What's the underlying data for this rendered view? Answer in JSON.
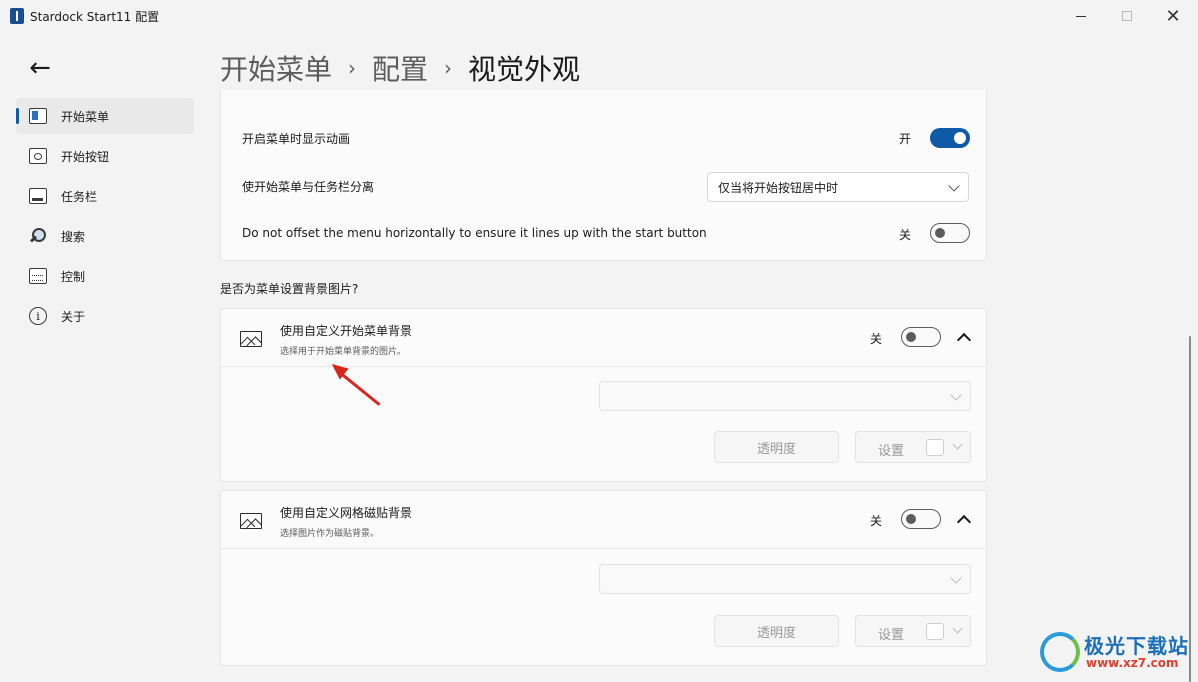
{
  "window": {
    "title": "Stardock Start11 配置",
    "minimize_icon": "minimize-icon",
    "maximize_icon": "maximize-icon",
    "close_icon": "close-icon",
    "close_glyph": "✕"
  },
  "back": {
    "glyph": "←"
  },
  "sidebar": {
    "items": [
      {
        "label": "开始菜单",
        "icon": "start-menu-icon",
        "active": true
      },
      {
        "label": "开始按钮",
        "icon": "start-button-icon"
      },
      {
        "label": "任务栏",
        "icon": "taskbar-icon"
      },
      {
        "label": "搜索",
        "icon": "search-icon"
      },
      {
        "label": "控制",
        "icon": "control-icon"
      },
      {
        "label": "关于",
        "icon": "info-icon"
      }
    ]
  },
  "breadcrumb": {
    "items": [
      "开始菜单",
      "配置",
      "视觉外观"
    ],
    "separator": "›"
  },
  "settings": {
    "animation": {
      "label": "开启菜单时显示动画",
      "state_label": "开",
      "on": true
    },
    "separate": {
      "label": "使开始菜单与任务栏分离",
      "value": "仅当将开始按钮居中时"
    },
    "offset": {
      "label": "Do not offset the menu horizontally to ensure it lines up with the start button",
      "state_label": "关",
      "on": false
    }
  },
  "background_section": {
    "heading": "是否为菜单设置背景图片?",
    "cards": [
      {
        "title": "使用自定义开始菜单背景",
        "subtitle": "选择用于开始菜单背景的图片。",
        "state_label": "关",
        "on": false,
        "select_value": "",
        "opacity_label": "透明度",
        "settings_label": "设置"
      },
      {
        "title": "使用自定义网格磁贴背景",
        "subtitle": "选择图片作为磁贴背景。",
        "state_label": "关",
        "on": false,
        "select_value": "",
        "opacity_label": "透明度",
        "settings_label": "设置"
      }
    ]
  },
  "watermark": {
    "name": "极光下载站",
    "url": "www.xz7.com"
  },
  "colors": {
    "accent": "#0e5aa7",
    "annotation": "#d9261c"
  }
}
